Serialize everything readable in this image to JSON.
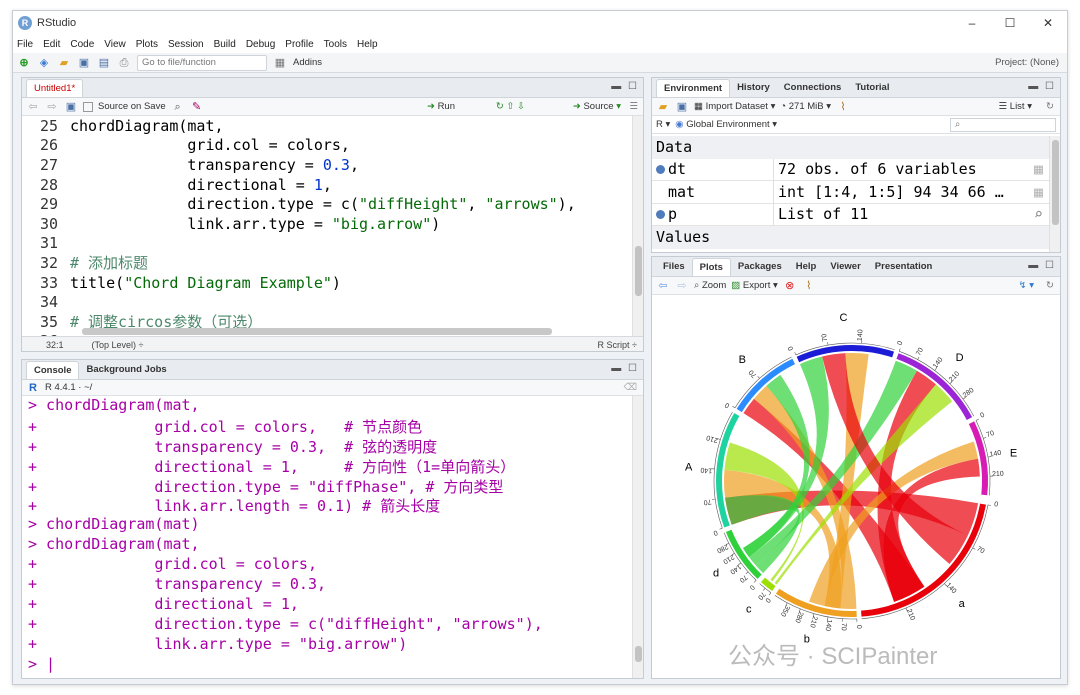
{
  "window": {
    "title": "RStudio",
    "minimize": "–",
    "maximize": "☐",
    "close": "✕"
  },
  "menu": [
    "File",
    "Edit",
    "Code",
    "View",
    "Plots",
    "Session",
    "Build",
    "Debug",
    "Profile",
    "Tools",
    "Help"
  ],
  "toolbar": {
    "goto_placeholder": "Go to file/function",
    "addins": "Addins",
    "project": "Project: (None)"
  },
  "editor": {
    "tab": "Untitled1*",
    "source_on_save": "Source on Save",
    "run": "Run",
    "source": "Source",
    "lines": [
      {
        "n": "25",
        "parts": [
          [
            "op",
            "chordDiagram(mat,"
          ]
        ]
      },
      {
        "n": "26",
        "parts": [
          [
            "op",
            "             grid.col = colors,"
          ]
        ]
      },
      {
        "n": "27",
        "parts": [
          [
            "op",
            "             transparency = "
          ],
          [
            "num",
            "0.3"
          ],
          [
            "op",
            ","
          ]
        ]
      },
      {
        "n": "28",
        "parts": [
          [
            "op",
            "             directional = "
          ],
          [
            "num",
            "1"
          ],
          [
            "op",
            ","
          ]
        ]
      },
      {
        "n": "29",
        "parts": [
          [
            "op",
            "             direction.type = c("
          ],
          [
            "str",
            "\"diffHeight\""
          ],
          [
            "op",
            ", "
          ],
          [
            "str",
            "\"arrows\""
          ],
          [
            "op",
            "),"
          ]
        ]
      },
      {
        "n": "30",
        "parts": [
          [
            "op",
            "             link.arr.type = "
          ],
          [
            "str",
            "\"big.arrow\""
          ],
          [
            "op",
            ")"
          ]
        ]
      },
      {
        "n": "31",
        "parts": [
          [
            "op",
            ""
          ]
        ]
      },
      {
        "n": "32",
        "parts": [
          [
            "cm",
            "# 添加标题"
          ]
        ]
      },
      {
        "n": "33",
        "parts": [
          [
            "op",
            "title("
          ],
          [
            "str",
            "\"Chord Diagram Example\""
          ],
          [
            "op",
            ")"
          ]
        ]
      },
      {
        "n": "34",
        "parts": [
          [
            "op",
            ""
          ]
        ]
      },
      {
        "n": "35",
        "parts": [
          [
            "cm",
            "# 调整circos参数（可选）"
          ]
        ]
      },
      {
        "n": "36",
        "parts": [
          [
            "op",
            ""
          ]
        ]
      }
    ],
    "status_pos": "32:1",
    "status_level": "(Top Level) ÷",
    "status_type": "R Script ÷"
  },
  "console": {
    "tab1": "Console",
    "tab2": "Background Jobs",
    "rversion": "R 4.4.1 · ~/",
    "lines": [
      "> chordDiagram(mat,",
      "+             grid.col = colors,   # 节点颜色",
      "+             transparency = 0.3,  # 弦的透明度",
      "+             directional = 1,     # 方向性（1=单向箭头）",
      "+             direction.type = \"diffPhase\", # 方向类型",
      "+             link.arr.length = 0.1) # 箭头长度",
      "> chordDiagram(mat)",
      "> chordDiagram(mat,",
      "+             grid.col = colors,",
      "+             transparency = 0.3,",
      "+             directional = 1,",
      "+             direction.type = c(\"diffHeight\", \"arrows\"),",
      "+             link.arr.type = \"big.arrow\")",
      "> |"
    ]
  },
  "environment": {
    "tabs": [
      "Environment",
      "History",
      "Connections",
      "Tutorial"
    ],
    "import_dataset": "Import Dataset",
    "memory": "271 MiB",
    "list_label": "List",
    "r_label": "R",
    "global_env": "Global Environment",
    "section_data": "Data",
    "section_values": "Values",
    "rows": [
      {
        "name": "dt",
        "value": "72 obs. of 6 variables",
        "bullet": true
      },
      {
        "name": "mat",
        "value": "int [1:4, 1:5] 94 34 66 …",
        "bullet": false
      },
      {
        "name": "p",
        "value": "List of  11",
        "bullet": true
      }
    ]
  },
  "plots": {
    "tabs": [
      "Files",
      "Plots",
      "Packages",
      "Help",
      "Viewer",
      "Presentation"
    ],
    "zoom": "Zoom",
    "export": "Export"
  },
  "chart_data": {
    "type": "chord",
    "sectors": [
      {
        "name": "A",
        "color": "#1fd3a0",
        "ticks": [
          "0",
          "70",
          "140",
          "210"
        ]
      },
      {
        "name": "B",
        "color": "#2a8cff",
        "ticks": [
          "0",
          "70"
        ]
      },
      {
        "name": "C",
        "color": "#1c1cd6",
        "ticks": [
          "0",
          "70",
          "140"
        ]
      },
      {
        "name": "D",
        "color": "#9b24d6",
        "ticks": [
          "0",
          "70",
          "140",
          "210",
          "280"
        ]
      },
      {
        "name": "E",
        "color": "#d61cb4",
        "ticks": [
          "0",
          "70",
          "140",
          "210"
        ]
      },
      {
        "name": "a",
        "color": "#e8000b",
        "ticks": [
          "0",
          "70",
          "140",
          "210"
        ]
      },
      {
        "name": "b",
        "color": "#f0a020",
        "ticks": [
          "0",
          "70",
          "140",
          "210",
          "280",
          "350"
        ]
      },
      {
        "name": "c",
        "color": "#9be000",
        "ticks": [
          "0",
          "70"
        ]
      },
      {
        "name": "d",
        "color": "#2fd13b",
        "ticks": [
          "0",
          "70",
          "140",
          "210",
          "280"
        ]
      }
    ]
  },
  "watermark": "公众号 · SCIPainter"
}
